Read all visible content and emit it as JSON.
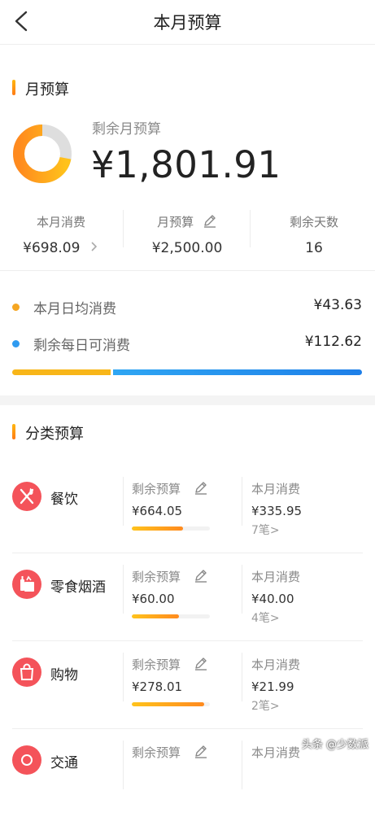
{
  "header": {
    "title": "本月预算"
  },
  "month_budget": {
    "section_title": "月预算",
    "remaining_label": "剩余月预算",
    "remaining_value": "¥1,801.91",
    "spent_fraction": 0.279,
    "stats": [
      {
        "label": "本月消费",
        "value": "¥698.09",
        "has_arrow": true
      },
      {
        "label": "月预算",
        "value": "¥2,500.00",
        "has_edit": true
      },
      {
        "label": "剩余天数",
        "value": "16"
      }
    ],
    "daily_avg": {
      "label": "本月日均消费",
      "value": "¥43.63",
      "color": "#f5a623"
    },
    "daily_left": {
      "label": "剩余每日可消费",
      "value": "¥112.62",
      "color": "#2f9bf0"
    }
  },
  "category_budget": {
    "section_title": "分类预算",
    "remaining_label": "剩余预算",
    "spent_label": "本月消费",
    "items": [
      {
        "name": "餐饮",
        "icon": "fork-knife-icon",
        "remaining": "¥664.05",
        "spent": "¥335.95",
        "count": "7笔>",
        "remaining_fraction": 0.66
      },
      {
        "name": "零食烟酒",
        "icon": "snack-drink-icon",
        "remaining": "¥60.00",
        "spent": "¥40.00",
        "count": "4笔>",
        "remaining_fraction": 0.6
      },
      {
        "name": "购物",
        "icon": "shopping-bag-icon",
        "remaining": "¥278.01",
        "spent": "¥21.99",
        "count": "2笔>",
        "remaining_fraction": 0.93
      },
      {
        "name": "交通",
        "icon": "transport-icon",
        "remaining_label": "剩余预算",
        "spent_label": "本月消费"
      }
    ]
  },
  "watermark": "头条 @少数派"
}
